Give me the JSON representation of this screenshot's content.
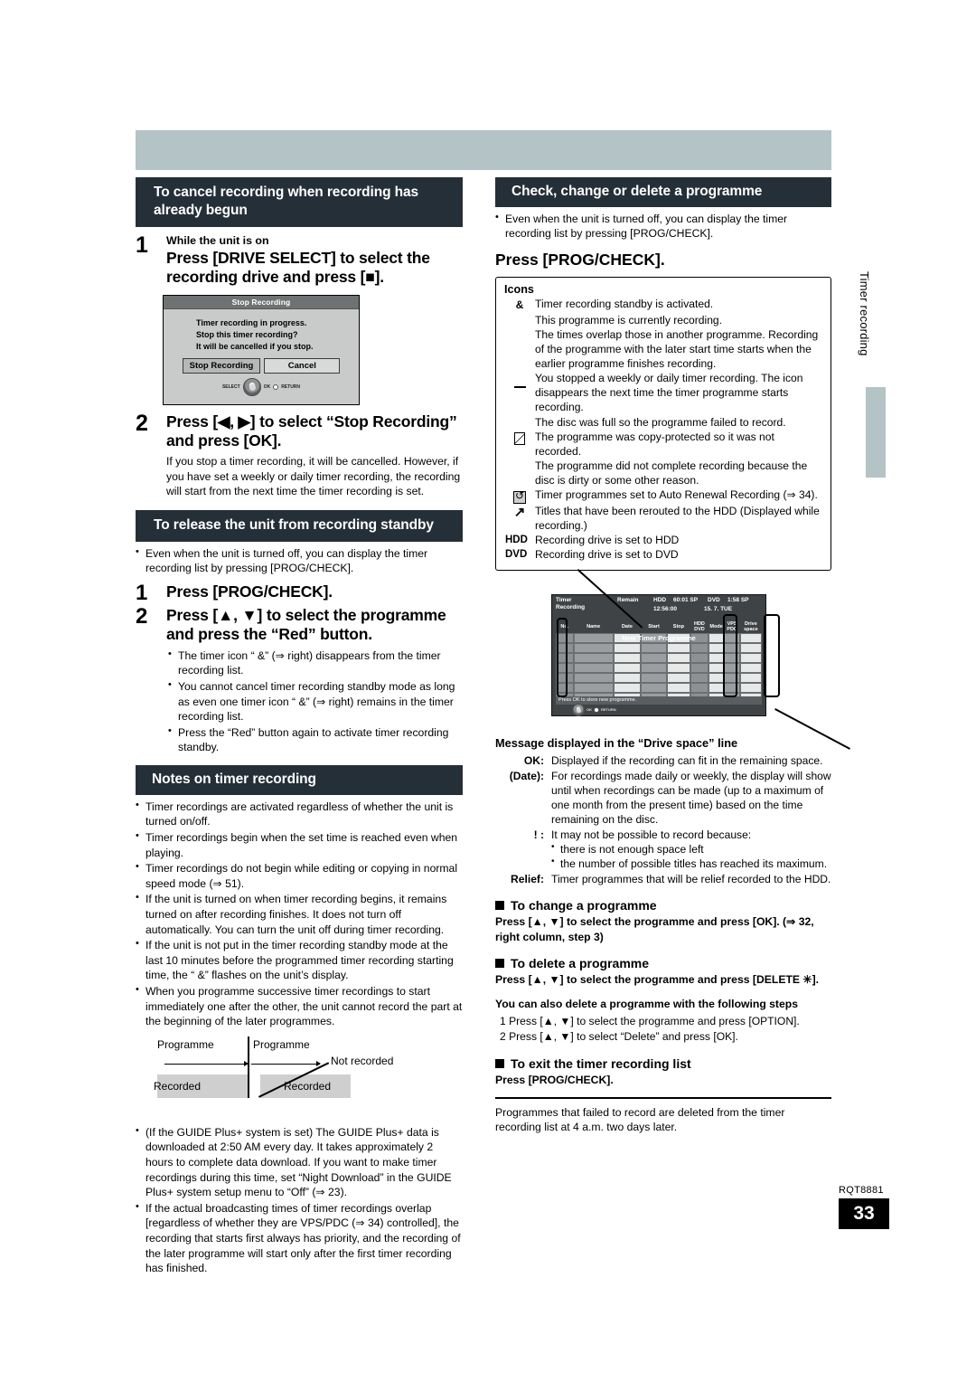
{
  "page": {
    "number": "33",
    "code": "RQT8881",
    "side_tab": "Timer recording"
  },
  "left_column": {
    "section1": {
      "banner": "To cancel recording when recording has already begun",
      "step1": {
        "num": "1",
        "lead": "While the unit is on",
        "headline": "Press [DRIVE SELECT] to select the recording drive and press [■]."
      },
      "osd": {
        "title": "Stop Recording",
        "lines": [
          "Timer recording in progress.",
          "Stop this timer recording?",
          "It will be cancelled if you stop."
        ],
        "button_primary": "Stop Recording",
        "button_secondary": "Cancel",
        "dpad_select": "SELECT",
        "dpad_ok": "OK",
        "dpad_return": "RETURN"
      },
      "step2": {
        "num": "2",
        "headline": "Press [◀, ▶] to select “Stop Recording” and press [OK].",
        "note": "If you stop a timer recording, it will be cancelled. However, if you have set a weekly or daily timer recording, the recording will start from the next time the timer recording is set."
      }
    },
    "section2": {
      "banner": "To release the unit from recording standby",
      "intro": "Even when the unit is turned off, you can display the timer recording list by pressing [PROG/CHECK].",
      "step1": {
        "num": "1",
        "headline": "Press [PROG/CHECK]."
      },
      "step2": {
        "num": "2",
        "headline": "Press [▲, ▼] to select the programme and press the “Red” button."
      },
      "bullets": [
        "The timer icon “ &” (⇒ right) disappears from the timer recording list.",
        "You cannot cancel timer recording standby mode as long as even one timer icon “ &” (⇒ right) remains in the timer recording list.",
        "Press the “Red” button again to activate timer recording standby."
      ]
    },
    "section3": {
      "banner": "Notes on timer recording",
      "bullets": [
        "Timer recordings are activated regardless of whether the unit is turned on/off.",
        "Timer recordings begin when the set time is reached even when playing.",
        "Timer recordings do not begin while editing or copying in normal speed mode (⇒ 51).",
        "If the unit is turned on when timer recording begins, it remains turned on after recording finishes. It does not turn off automatically. You can turn the unit off during timer recording.",
        "If the unit is not put in the timer recording standby mode at the last 10 minutes before the programmed timer recording starting time, the “ &” flashes on the unit’s display.",
        "When you programme successive timer recordings to start immediately one after the other, the unit cannot record the part at the beginning of the later programmes."
      ],
      "diagram": {
        "label_prog1": "Programme",
        "label_prog2": "Programme",
        "label_not_recorded": "Not recorded",
        "label_rec1": "Recorded",
        "label_rec2": "Recorded"
      },
      "bullets2": [
        "(If the GUIDE Plus+ system is set) The GUIDE Plus+ data is downloaded at 2:50 AM every day. It takes approximately 2 hours to complete data download. If you want to make timer recordings during this time, set “Night Download” in the GUIDE Plus+ system setup menu to “Off” (⇒ 23).",
        "If the actual broadcasting times of timer recordings overlap [regardless of whether they are VPS/PDC (⇒ 34) controlled], the recording that starts first always has priority, and the recording of the later programme will start only after the first timer recording has finished."
      ]
    }
  },
  "right_column": {
    "banner": "Check, change or delete a programme",
    "intro": "Even when the unit is turned off, you can display the timer recording list by pressing [PROG/CHECK].",
    "main_instruction": "Press [PROG/CHECK].",
    "icons_box": {
      "title": "Icons",
      "rows": [
        {
          "icon": "timer-standby-icon",
          "glyph": "&",
          "text": "Timer recording standby is activated."
        },
        {
          "icon": "recording-now-icon",
          "glyph": "",
          "text": "This programme is currently recording."
        },
        {
          "icon": "overlap-icon",
          "glyph": "",
          "text": "The times overlap those in another programme. Recording of the programme with the later start time starts when the earlier programme finishes recording."
        },
        {
          "icon": "stopped-weekly-icon",
          "glyph": "—",
          "text": "You stopped a weekly or daily timer recording. The icon disappears the next time the timer programme starts recording."
        },
        {
          "icon": "disc-full-icon",
          "glyph": "",
          "text": "The disc was full so the programme failed to record."
        },
        {
          "icon": "copy-protected-icon",
          "glyph": "copy",
          "text": "The programme was copy-protected so it was not recorded."
        },
        {
          "icon": "incomplete-icon",
          "glyph": "",
          "text": "The programme did not complete recording because the disc is dirty or some other reason."
        },
        {
          "icon": "auto-renewal-icon",
          "glyph": "renew",
          "text": "Timer programmes set to Auto Renewal Recording (⇒ 34)."
        },
        {
          "icon": "rerouted-hdd-icon",
          "glyph": "reroute",
          "text": "Titles that have been rerouted to the HDD (Displayed while recording.)"
        },
        {
          "icon": "hdd-label",
          "glyph": "HDD",
          "text": "Recording drive is set to HDD"
        },
        {
          "icon": "dvd-label",
          "glyph": "DVD",
          "text": "Recording drive is set to DVD"
        }
      ]
    },
    "tv_screen": {
      "title_line1": "Timer",
      "title_line2": "Recording",
      "remain_label": "Remain",
      "hdd_label": "HDD",
      "hdd_value": "60:01 SP",
      "dvd_label": "DVD",
      "dvd_value": "1:58 SP",
      "clock": "12:56:00",
      "date": "15. 7. TUE",
      "columns": [
        "No.",
        "Name",
        "Date",
        "Start",
        "Stop",
        "HDD DVD",
        "Mode",
        "VPS PDC",
        "Drive space"
      ],
      "new_programme_row": "New Timer Programme",
      "status": "Press OK to store new programme.",
      "dpad_ok": "OK",
      "dpad_return": "RETURN"
    },
    "drive_space": {
      "title": "Message displayed in the “Drive space” line",
      "rows": [
        {
          "key": "OK:",
          "value": "Displayed if the recording can fit in the remaining space."
        },
        {
          "key": "(Date):",
          "value": "For recordings made daily or weekly, the display will show until when recordings can be made (up to a maximum of one month from the present time) based on the time remaining on the disc."
        },
        {
          "key": "! :",
          "value": "It may not be possible to record because:",
          "sub": [
            "there is not enough space left",
            "the number of possible titles has reached its maximum."
          ]
        },
        {
          "key": "Relief:",
          "value": "Timer programmes that will be relief recorded to the HDD."
        }
      ]
    },
    "change_programme": {
      "heading": "To change a programme",
      "body": "Press [▲, ▼] to select the programme and press [OK]. (⇒ 32, right column, step 3)"
    },
    "delete_programme": {
      "heading": "To delete a programme",
      "body": "Press [▲, ▼] to select the programme and press [DELETE ✳].",
      "alt_heading": "You can also delete a programme with the following steps",
      "steps": [
        "1  Press [▲, ▼] to select the programme and press [OPTION].",
        "2  Press [▲, ▼] to select “Delete” and press [OK]."
      ]
    },
    "exit_list": {
      "heading": "To exit the timer recording list",
      "body": "Press [PROG/CHECK]."
    },
    "footnote": "Programmes that failed to record are deleted from the timer recording list at 4 a.m. two days later."
  },
  "colors": {
    "banner_bg": "#252f38",
    "top_bar": "#b3c3c6",
    "diagram_gray": "#cfcfcf"
  }
}
